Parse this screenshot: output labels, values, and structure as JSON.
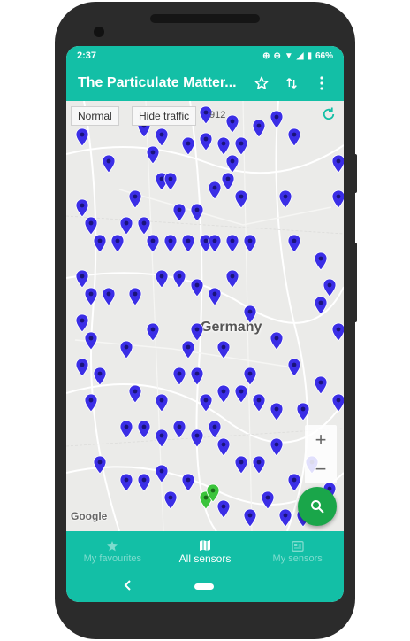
{
  "status_bar": {
    "time": "2:37",
    "battery": "66%"
  },
  "toolbar": {
    "title": "The Particulate Matter..."
  },
  "map": {
    "mode_label": "Normal",
    "traffic_label": "Hide traffic",
    "sensor_count": "912",
    "country_label": "Germany",
    "attribution": "Google",
    "zoom_in_label": "+",
    "zoom_out_label": "−"
  },
  "bottom_nav": {
    "items": [
      {
        "label": "My favourites",
        "icon": "star-icon"
      },
      {
        "label": "All sensors",
        "icon": "map-icon"
      },
      {
        "label": "My sensors",
        "icon": "sensor-card-icon"
      }
    ]
  },
  "colors": {
    "primary": "#13bfa6",
    "pin": "#3b2ee6",
    "pin_highlight": "#3bc43b",
    "fab": "#1aa64a"
  }
}
